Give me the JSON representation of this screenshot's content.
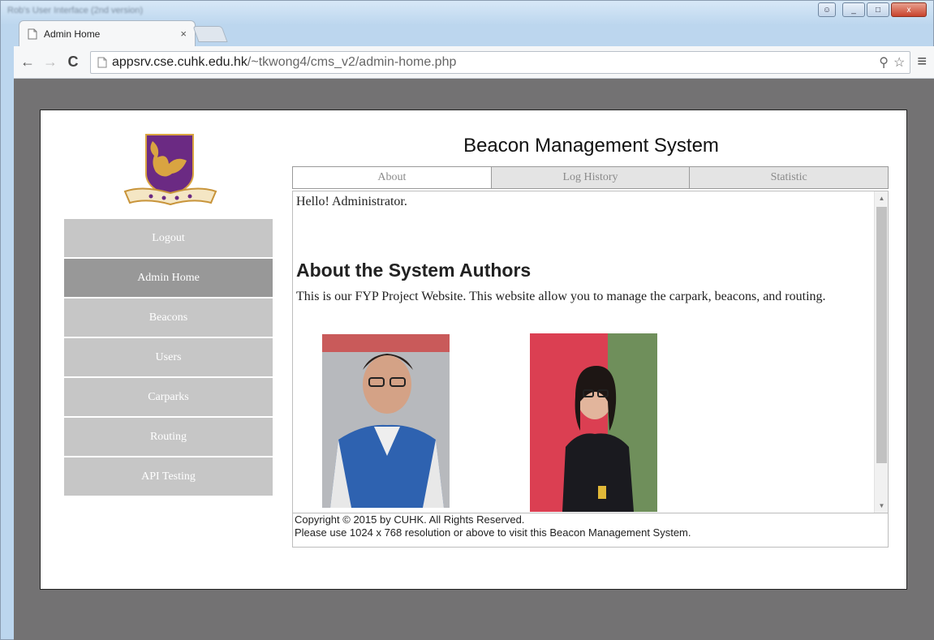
{
  "window": {
    "title": "Rob's User Interface (2nd version)",
    "controls": {
      "user_icon": "user-icon",
      "minimize": "_",
      "maximize": "□",
      "close": "x"
    }
  },
  "browser": {
    "tab_title": "Admin Home",
    "tab_close": "×",
    "url_domain": "appsrv.cse.cuhk.edu.hk",
    "url_path": "/~tkwong4/cms_v2/admin-home.php",
    "back": "←",
    "forward": "→",
    "reload": "C",
    "menu": "≡",
    "extension_icon": "⚲",
    "star": "☆"
  },
  "site": {
    "title": "Beacon Management System",
    "nav": [
      {
        "label": "Logout",
        "active": false
      },
      {
        "label": "Admin Home",
        "active": true
      },
      {
        "label": "Beacons",
        "active": false
      },
      {
        "label": "Users",
        "active": false
      },
      {
        "label": "Carparks",
        "active": false
      },
      {
        "label": "Routing",
        "active": false
      },
      {
        "label": "API Testing",
        "active": false
      }
    ],
    "tabs": [
      {
        "label": "About",
        "active": true
      },
      {
        "label": "Log History",
        "active": false
      },
      {
        "label": "Statistic",
        "active": false
      }
    ],
    "content": {
      "greeting": "Hello! Administrator.",
      "heading": "About the System Authors",
      "text": "This is our FYP Project Website. This website allow you to manage the carpark, beacons, and routing."
    },
    "footer": {
      "copyright": "Copyright © 2015 by CUHK. All Rights Reserved.",
      "resolution_note": "Please use 1024 x 768 resolution or above to visit this Beacon Management System."
    }
  },
  "colors": {
    "nav_bg": "#c6c6c6",
    "nav_active_bg": "#989898",
    "page_backdrop": "#737273",
    "logo_purple": "#6b2a83",
    "logo_gold": "#d9a441"
  }
}
